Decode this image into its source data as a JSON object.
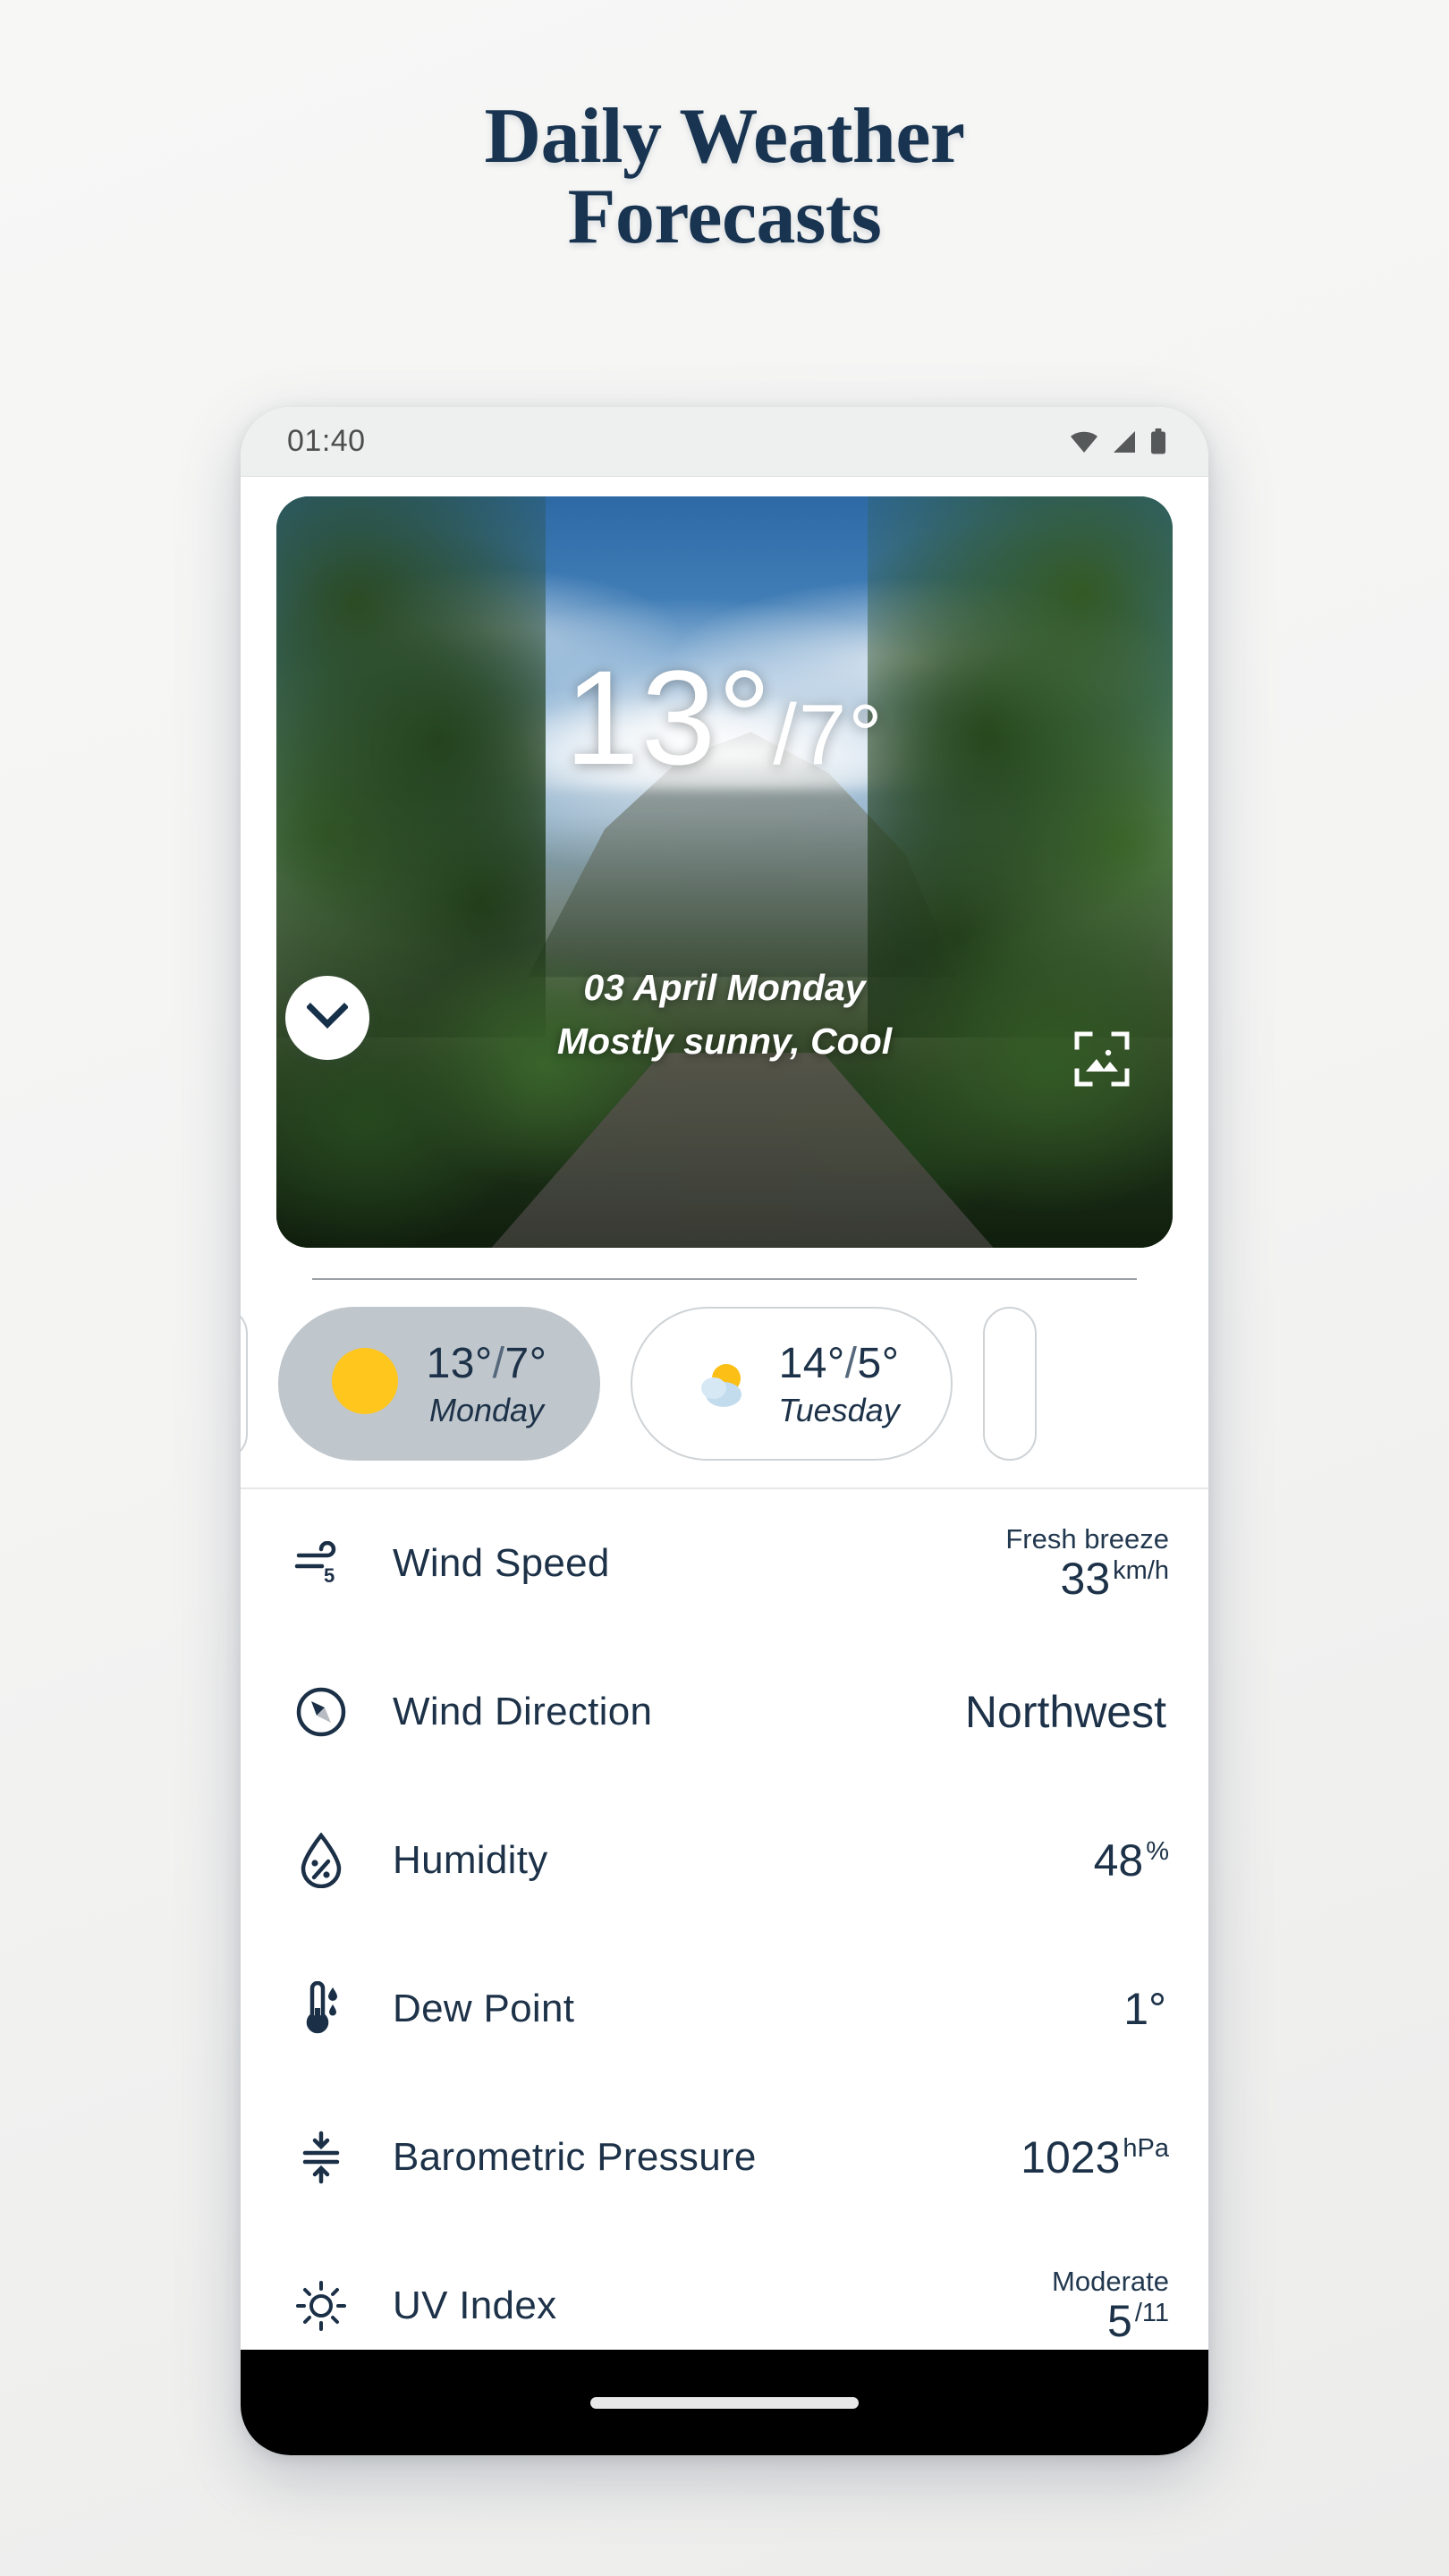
{
  "page": {
    "heading_line1": "Daily Weather",
    "heading_line2": "Forecasts",
    "heading_color": "#183451"
  },
  "status_bar": {
    "time": "01:40",
    "icons": [
      "wifi-icon",
      "cellular-signal-icon",
      "battery-icon"
    ]
  },
  "hero": {
    "collapse_icon": "chevron-down-icon",
    "image_icon": "image-picker-icon",
    "temp_high": "13°",
    "temp_separator": "/",
    "temp_low": "7°",
    "date": "03 April Monday",
    "description": "Mostly sunny, Cool",
    "background": "tropical-rainforest-photo"
  },
  "day_strip": {
    "days": [
      {
        "label": "Monday",
        "high": "13°",
        "sep": "/",
        "low": "7°",
        "icon": "sunny-icon",
        "selected": true
      },
      {
        "label": "Tuesday",
        "high": "14°",
        "sep": "/",
        "low": "5°",
        "icon": "partly-cloudy-icon",
        "selected": false
      }
    ],
    "selected_bg": "#bfc6cc",
    "sun_color": "#ffc61e"
  },
  "details": [
    {
      "icon": "wind-speed-icon",
      "label": "Wind Speed",
      "sub": "Fresh breeze",
      "value": "33",
      "unit": "km/h"
    },
    {
      "icon": "compass-icon",
      "label": "Wind Direction",
      "sub": "",
      "value": "Northwest",
      "unit": ""
    },
    {
      "icon": "humidity-droplet-icon",
      "label": "Humidity",
      "sub": "",
      "value": "48",
      "unit": "%"
    },
    {
      "icon": "thermometer-dew-icon",
      "label": "Dew Point",
      "sub": "",
      "value": "1°",
      "unit": ""
    },
    {
      "icon": "pressure-arrows-icon",
      "label": "Barometric Pressure",
      "sub": "",
      "value": "1023",
      "unit": "hPa"
    },
    {
      "icon": "uv-sun-icon",
      "label": "UV Index",
      "sub": "Moderate",
      "value": "5",
      "unit": "/11"
    }
  ],
  "nav_bar": {
    "gesture_pill": "home-gesture-pill"
  }
}
